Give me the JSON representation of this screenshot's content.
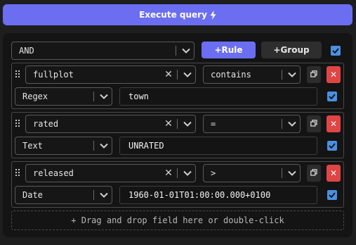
{
  "execute_button": {
    "label": "Execute query",
    "icon": "lightning-bolt-icon"
  },
  "query_builder": {
    "combinator": {
      "value": "AND",
      "icon": "chevron-down-icon"
    },
    "add_rule_label": "+Rule",
    "add_group_label": "+Group",
    "group_enabled": true,
    "rules": [
      {
        "field": "fullplot",
        "operator": "contains",
        "value_type": "Regex",
        "value": "town",
        "enabled": true
      },
      {
        "field": "rated",
        "operator": "=",
        "value_type": "Text",
        "value": "UNRATED",
        "enabled": true
      },
      {
        "field": "released",
        "operator": ">",
        "value_type": "Date",
        "value": "1960-01-01T01:00:00.000+0100",
        "enabled": true
      }
    ],
    "dropzone_text": "+ Drag and drop field here or double-click"
  },
  "colors": {
    "accent": "#6b6ef0",
    "danger": "#e04545",
    "checkbox": "#4a90e2",
    "background": "#1e1e1e",
    "panel": "#141414"
  }
}
